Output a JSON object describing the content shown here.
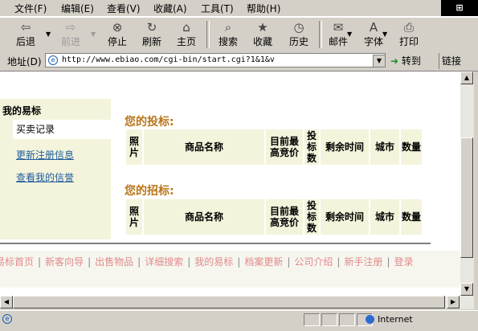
{
  "menubar": {
    "items": [
      "文件(F)",
      "编辑(E)",
      "查看(V)",
      "收藏(A)",
      "工具(T)",
      "帮助(H)"
    ]
  },
  "toolbar": {
    "buttons": [
      {
        "label": "后退",
        "icon": "back-arrow-icon",
        "enabled": true
      },
      {
        "label": "前进",
        "icon": "forward-arrow-icon",
        "enabled": false
      },
      {
        "label": "停止",
        "icon": "stop-icon",
        "enabled": true
      },
      {
        "label": "刷新",
        "icon": "refresh-icon",
        "enabled": true
      },
      {
        "label": "主页",
        "icon": "home-icon",
        "enabled": true
      },
      {
        "label": "搜索",
        "icon": "search-icon",
        "enabled": true
      },
      {
        "label": "收藏",
        "icon": "favorites-icon",
        "enabled": true
      },
      {
        "label": "历史",
        "icon": "history-icon",
        "enabled": true
      },
      {
        "label": "邮件",
        "icon": "mail-icon",
        "enabled": true
      },
      {
        "label": "字体",
        "icon": "font-icon",
        "enabled": true
      },
      {
        "label": "打印",
        "icon": "print-icon",
        "enabled": true
      }
    ]
  },
  "addressbar": {
    "label": "地址(D)",
    "url": "http://www.ebiao.com/cgi-bin/start.cgi?1&1&v",
    "go_label": "转到",
    "links_label": "链接"
  },
  "sidebar": {
    "title": "我的易标",
    "current": "买卖记录",
    "links": [
      "更新注册信息",
      "查看我的信誉"
    ]
  },
  "bids": {
    "title": "您的投标:",
    "columns": [
      "照片",
      "商品名称",
      "目前最高竞价",
      "投标数",
      "剩余时间",
      "城市",
      "数量"
    ]
  },
  "invites": {
    "title": "您的招标:",
    "columns": [
      "照片",
      "商品名称",
      "目前最高竞价",
      "投标数",
      "剩余时间",
      "城市",
      "数量"
    ]
  },
  "footer": {
    "links": [
      "易标首页",
      "新客向导",
      "出售物品",
      "详细搜索",
      "我的易标",
      "档案更新",
      "公司介绍",
      "新手注册",
      "登录"
    ]
  },
  "statusbar": {
    "zone": "Internet"
  },
  "colors": {
    "chrome": "#d4d0c8",
    "panel": "#f4f4dc",
    "section_title": "#b8761a",
    "link": "#1d5b9c",
    "footer_link": "#e08a8a"
  }
}
